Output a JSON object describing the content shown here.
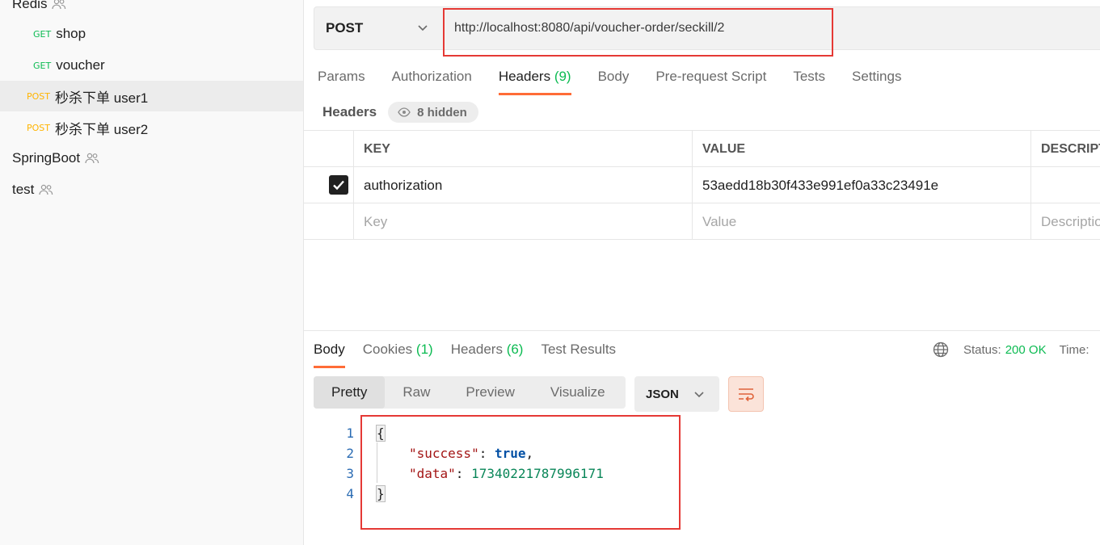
{
  "sidebar": {
    "items": [
      {
        "label": "Redis",
        "type": "collection"
      },
      {
        "method": "GET",
        "label": "shop"
      },
      {
        "method": "GET",
        "label": "voucher"
      },
      {
        "method": "POST",
        "label": "秒杀下单 user1"
      },
      {
        "method": "POST",
        "label": "秒杀下单 user2"
      },
      {
        "label": "SpringBoot",
        "type": "collection"
      },
      {
        "label": "test",
        "type": "collection"
      }
    ]
  },
  "request": {
    "method": "POST",
    "url": "http://localhost:8080/api/voucher-order/seckill/2"
  },
  "tabs": [
    {
      "label": "Params"
    },
    {
      "label": "Authorization"
    },
    {
      "label": "Headers",
      "count": "(9)"
    },
    {
      "label": "Body"
    },
    {
      "label": "Pre-request Script"
    },
    {
      "label": "Tests"
    },
    {
      "label": "Settings"
    }
  ],
  "headers_section": {
    "title": "Headers",
    "hidden_label": "8 hidden"
  },
  "table": {
    "columns": [
      "KEY",
      "VALUE",
      "DESCRIPT"
    ],
    "rows": [
      {
        "checked": true,
        "key": "authorization",
        "value": "53aedd18b30f433e991ef0a33c23491e",
        "description": ""
      }
    ],
    "placeholders": {
      "key": "Key",
      "value": "Value",
      "description": "Descriptio"
    }
  },
  "response": {
    "tabs": [
      {
        "label": "Body"
      },
      {
        "label": "Cookies",
        "count": "(1)"
      },
      {
        "label": "Headers",
        "count": "(6)"
      },
      {
        "label": "Test Results"
      }
    ],
    "status_label": "Status:",
    "status_value": "200 OK",
    "time_label": "Time:",
    "views": [
      "Pretty",
      "Raw",
      "Preview",
      "Visualize"
    ],
    "format": "JSON",
    "code": {
      "line_numbers": [
        "1",
        "2",
        "3",
        "4"
      ],
      "open": "{",
      "success_key": "\"success\"",
      "success_val": "true",
      "data_key": "\"data\"",
      "data_val": "17340221787996171",
      "close": "}"
    }
  },
  "colors": {
    "accent": "#ff6c37",
    "get": "#0cbb52",
    "post": "#ffb400",
    "highlight_box": "#e53935"
  }
}
